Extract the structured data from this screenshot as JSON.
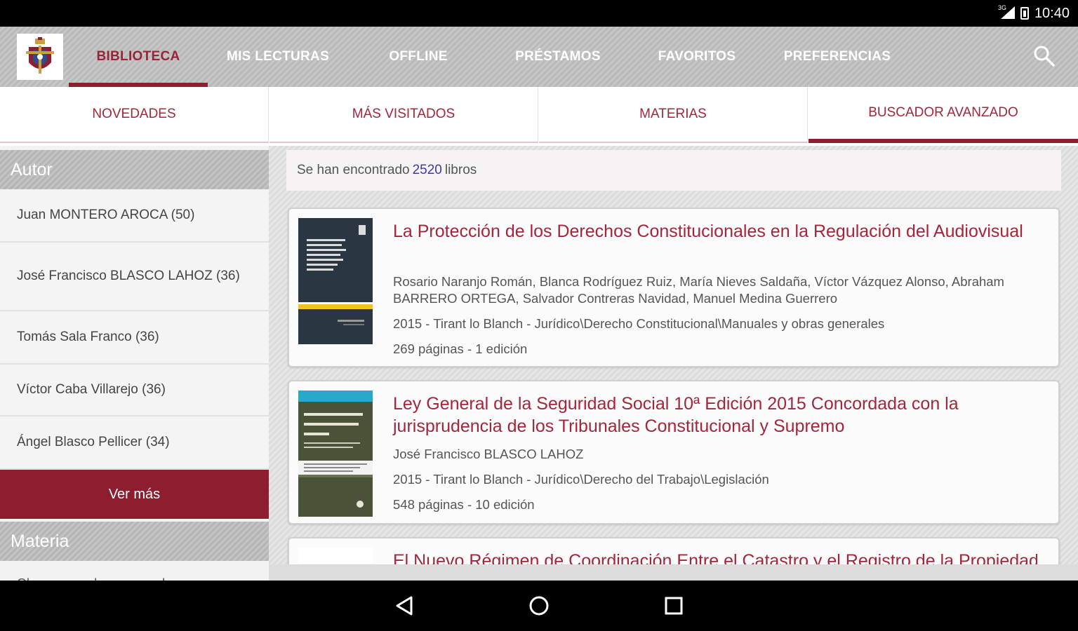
{
  "status": {
    "network": "3G",
    "time": "10:40"
  },
  "top_tabs": [
    {
      "label": "BIBLIOTECA",
      "active": true
    },
    {
      "label": "MIS LECTURAS"
    },
    {
      "label": "OFFLINE"
    },
    {
      "label": "PRÉSTAMOS"
    },
    {
      "label": "FAVORITOS"
    },
    {
      "label": "PREFERENCIAS"
    }
  ],
  "sub_tabs": [
    {
      "label": "NOVEDADES"
    },
    {
      "label": "MÁS VISITADOS"
    },
    {
      "label": "MATERIAS"
    },
    {
      "label": "BUSCADOR AVANZADO",
      "active": true
    }
  ],
  "sidebar": {
    "autor_header": "Autor",
    "autores": [
      "Juan MONTERO AROCA (50)",
      "José Francisco BLASCO LAHOZ (36)",
      "Tomás Sala Franco (36)",
      "Víctor Caba Villarejo (36)",
      "Ángel Blasco Pellicer (34)"
    ],
    "more_label": "Ver más",
    "materia_header": "Materia",
    "materia_first": "Obras generales y manuales"
  },
  "results": {
    "prefix": "Se han encontrado",
    "count": "2520",
    "suffix": "libros"
  },
  "books": [
    {
      "title": "La Protección de los Derechos Constitucionales en la Regulación del Audiovisual",
      "authors": "Rosario Naranjo Román,  Blanca Rodríguez Ruiz,  María Nieves Saldaña, Víctor Vázquez Alonso, Abraham BARRERO ORTEGA,  Salvador Contreras Navidad, Manuel Medina Guerrero",
      "info": "2015 - Tirant lo Blanch - Jurídico\\Derecho Constitucional\\Manuales y obras generales",
      "pages": "269 páginas - 1 edición"
    },
    {
      "title": "Ley General de la Seguridad Social 10ª Edición 2015 Concordada con la jurisprudencia de los Tribunales Constitucional y Supremo",
      "authors": "José Francisco BLASCO LAHOZ",
      "info": "2015 - Tirant lo Blanch - Jurídico\\Derecho del Trabajo\\Legislación",
      "pages": "548 páginas - 10 edición"
    },
    {
      "title": "El Nuevo Régimen de Coordinación Entre el Catastro y el Registro de la Propiedad"
    }
  ],
  "colors": {
    "accent": "#8e1e2f",
    "title": "#a3263b",
    "link_count": "#3b3ba8"
  }
}
